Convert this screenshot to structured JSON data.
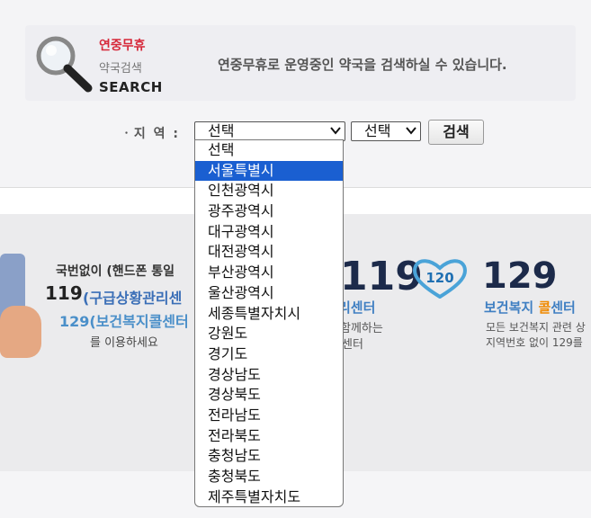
{
  "header": {
    "logo": {
      "line1": "연중무휴",
      "line2": "약국검색",
      "line3": "SEARCH"
    },
    "description": "연중무휴로 운영중인 약국을 검색하실 수 있습니다."
  },
  "form": {
    "region_label": "ㆍ지 역 :",
    "select1_value": "선택",
    "select2_value": "선택",
    "search_button": "검색",
    "dropdown_options": [
      "선택",
      "서울특별시",
      "인천광역시",
      "광주광역시",
      "대구광역시",
      "대전광역시",
      "부산광역시",
      "울산광역시",
      "세종특별자치시",
      "강원도",
      "경기도",
      "경상남도",
      "경상북도",
      "전라남도",
      "전라북도",
      "충청남도",
      "충청북도",
      "제주특별자치도"
    ],
    "highlighted_option": "서울특별시"
  },
  "bottom_banner": {
    "left": {
      "line1": "국번없이 (핸드폰 통일",
      "line2_num": "119",
      "line2_text": "(구급상황관리센",
      "line3": "129(보건복지콜센터",
      "line4": "를 이용하세요"
    },
    "center": {
      "big": "119",
      "line1": "리센터",
      "line2": "함께하는",
      "line3": "센터"
    },
    "right": {
      "heart_text": "120",
      "big": "129",
      "line1_a": "보건복지 ",
      "line1_b": "콜",
      "line1_c": "센터",
      "line2": "모든 보건복지 관련 상",
      "line3": "지역번호 없이 129를"
    }
  },
  "colors": {
    "accent_red": "#d6283a",
    "accent_blue": "#3f7fc2",
    "highlight": "#1a5fd1",
    "orange": "#f08a00"
  }
}
